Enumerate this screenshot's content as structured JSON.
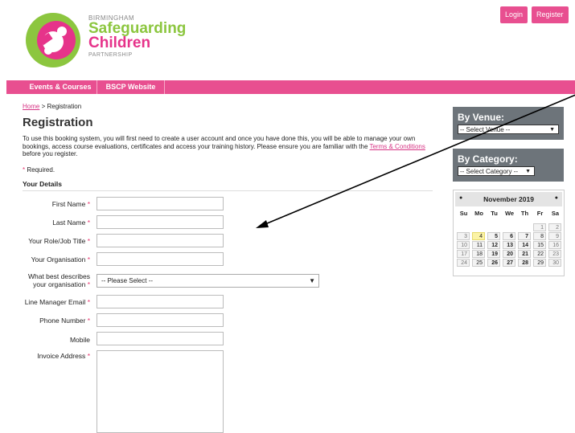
{
  "header": {
    "logo_small_top": "BIRMINGHAM",
    "logo_line1": "Safeguarding",
    "logo_line2": "Children",
    "logo_small_bottom": "PARTNERSHIP",
    "login_label": "Login",
    "register_label": "Register"
  },
  "nav": {
    "items": [
      "Events & Courses",
      "BSCP Website"
    ]
  },
  "breadcrumb": {
    "home": "Home",
    "sep": " > ",
    "current": "Registration"
  },
  "page": {
    "title": "Registration",
    "intro_part1": "To use this booking system, you will first need to create a user account and once you have done this, you will be able to manage your own bookings, access course evaluations, certificates and access your training history. Please ensure you are familiar with the ",
    "intro_link": "Terms & Conditions",
    "intro_part2": " before you register.",
    "required_star": "*",
    "required_text": " Required.",
    "section_title": "Your Details"
  },
  "form": {
    "first_name": "First Name",
    "last_name": "Last Name",
    "role": "Your Role/Job Title",
    "organisation": "Your Organisation",
    "describes_1": "What best describes",
    "describes_2": "your organisation",
    "describes_value": "-- Please Select --",
    "line_manager": "Line Manager Email",
    "phone": "Phone Number",
    "mobile": "Mobile",
    "invoice": "Invoice Address",
    "star": "*"
  },
  "sidebar": {
    "venue_title": "By Venue:",
    "venue_value": "-- Select Venue --",
    "category_title": "By Category:",
    "category_value": "-- Select Category --"
  },
  "calendar": {
    "title": "November 2019",
    "dow": [
      "Su",
      "Mo",
      "Tu",
      "We",
      "Th",
      "Fr",
      "Sa"
    ],
    "weeks": [
      [
        "",
        "",
        "",
        "",
        "",
        "1",
        "2"
      ],
      [
        "3",
        "4",
        "5",
        "6",
        "7",
        "8",
        "9"
      ],
      [
        "10",
        "11",
        "12",
        "13",
        "14",
        "15",
        "16"
      ],
      [
        "17",
        "18",
        "19",
        "20",
        "21",
        "22",
        "23"
      ],
      [
        "24",
        "25",
        "26",
        "27",
        "28",
        "29",
        "30"
      ]
    ],
    "today": "4"
  },
  "colors": {
    "brand_pink": "#e84f90",
    "brand_green": "#8cc63f",
    "sidebar_grey": "#6d747a"
  }
}
